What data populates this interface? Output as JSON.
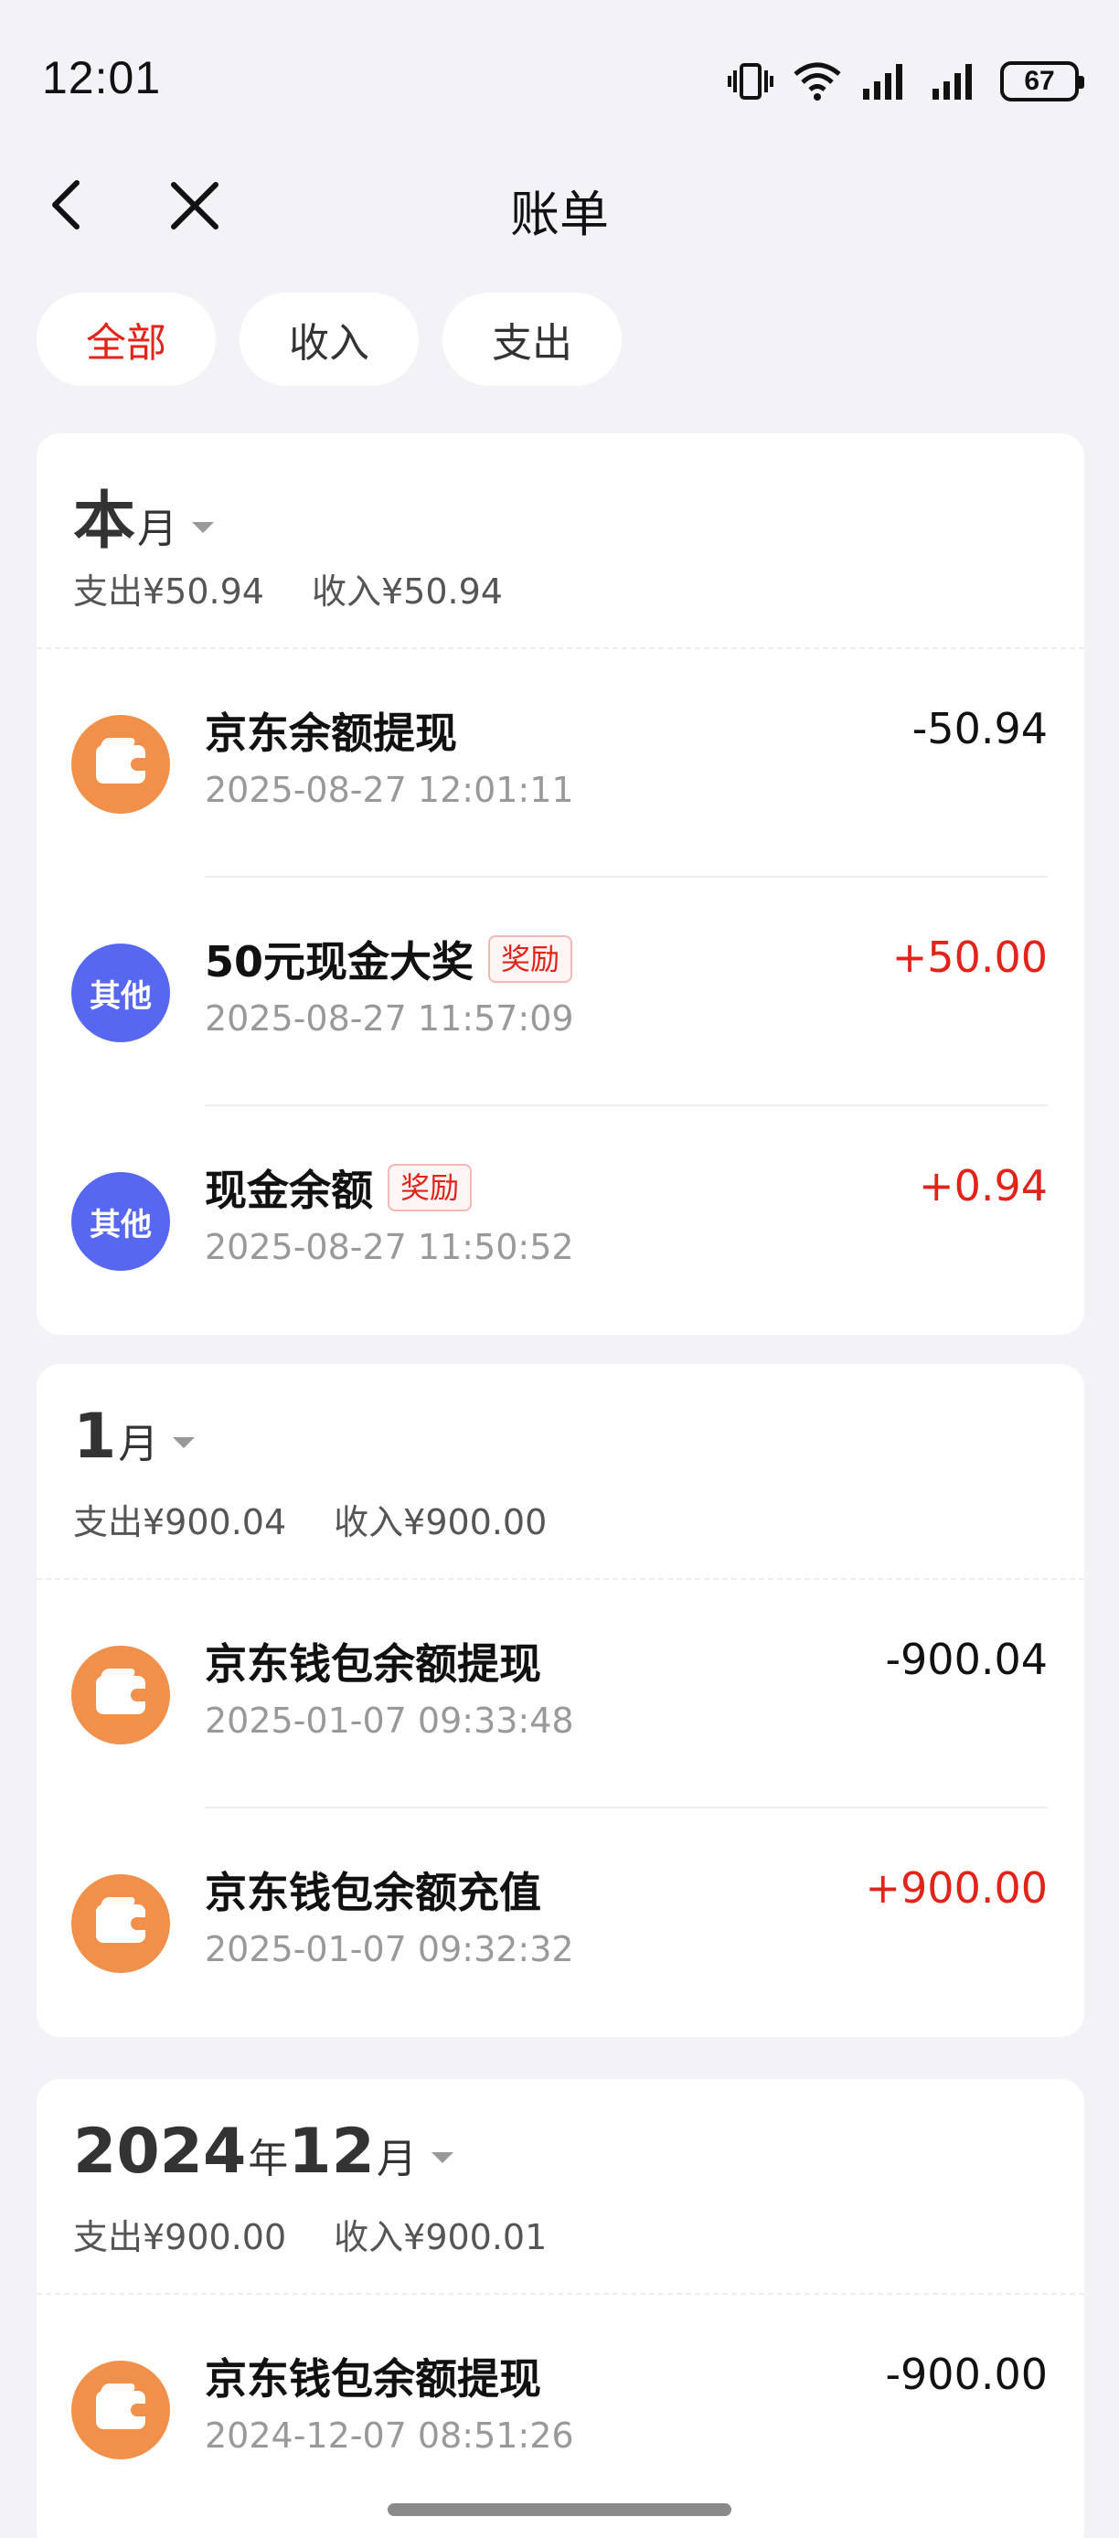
{
  "status_bar": {
    "time": "12:01",
    "battery": "67",
    "icons": [
      "vibrate-icon",
      "wifi-icon",
      "signal-icon",
      "signal-icon",
      "battery-icon"
    ]
  },
  "nav": {
    "title": "账单",
    "back_icon": "chevron-left-icon",
    "close_icon": "close-icon"
  },
  "tabs": [
    {
      "label": "全部",
      "active": true
    },
    {
      "label": "收入",
      "active": false
    },
    {
      "label": "支出",
      "active": false
    }
  ],
  "colors": {
    "accent": "#e2231a",
    "wallet_icon_bg": "#f0904a",
    "other_icon_bg": "#5767f0",
    "page_bg": "#f3f3f7"
  },
  "sections": [
    {
      "month_big": "本",
      "month_small": "月",
      "year_big": "",
      "year_small": "",
      "expense": "支出¥50.94",
      "income": "收入¥50.94",
      "transactions": [
        {
          "icon": "wallet-icon",
          "icon_text": "",
          "title": "京东余额提现",
          "tag": "",
          "time": "2025-08-27 12:01:11",
          "amount": "-50.94",
          "positive": false
        },
        {
          "icon": "other-icon",
          "icon_text": "其他",
          "title": "50元现金大奖",
          "tag": "奖励",
          "time": "2025-08-27 11:57:09",
          "amount": "+50.00",
          "positive": true
        },
        {
          "icon": "other-icon",
          "icon_text": "其他",
          "title": "现金余额",
          "tag": "奖励",
          "time": "2025-08-27 11:50:52",
          "amount": "+0.94",
          "positive": true
        }
      ]
    },
    {
      "month_big": "1",
      "month_small": "月",
      "year_big": "",
      "year_small": "",
      "expense": "支出¥900.04",
      "income": "收入¥900.00",
      "transactions": [
        {
          "icon": "wallet-icon",
          "icon_text": "",
          "title": "京东钱包余额提现",
          "tag": "",
          "time": "2025-01-07 09:33:48",
          "amount": "-900.04",
          "positive": false
        },
        {
          "icon": "wallet-icon",
          "icon_text": "",
          "title": "京东钱包余额充值",
          "tag": "",
          "time": "2025-01-07 09:32:32",
          "amount": "+900.00",
          "positive": true
        }
      ]
    },
    {
      "month_big": "12",
      "month_small": "月",
      "year_big": "2024",
      "year_small": "年",
      "expense": "支出¥900.00",
      "income": "收入¥900.01",
      "transactions": [
        {
          "icon": "wallet-icon",
          "icon_text": "",
          "title": "京东钱包余额提现",
          "tag": "",
          "time": "2024-12-07 08:51:26",
          "amount": "-900.00",
          "positive": false
        }
      ]
    }
  ]
}
